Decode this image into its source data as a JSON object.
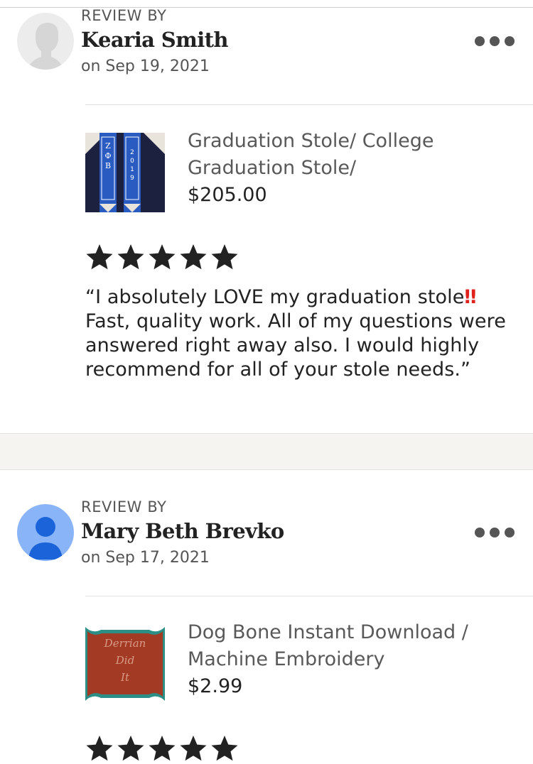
{
  "reviews": [
    {
      "review_by_label": "REVIEW BY",
      "name": "Kearia Smith",
      "date": "on Sep 19, 2021",
      "avatar": "default-silhouette-avatar",
      "menu_icon": "more-dots-icon",
      "product": {
        "title": "Graduation Stole/ College Graduation Stole/",
        "price": "$205.00",
        "image": "graduation-stole-photo"
      },
      "rating": 5,
      "text": "“I absolutely LOVE my graduation stole",
      "text_emoji": "‼",
      "text_rest": " Fast, quality work. All of my questions were answered right away also. I would highly recommend for all of your stole needs.”"
    },
    {
      "review_by_label": "REVIEW BY",
      "name": "Mary Beth Brevko",
      "date": "on Sep 17, 2021",
      "avatar": "blue-person-avatar",
      "menu_icon": "more-dots-icon",
      "product": {
        "title": "Dog Bone Instant Download / Machine Embroidery",
        "price": "$2.99",
        "image": "dog-bone-embroidery-photo",
        "image_text": [
          "Derrian",
          "Did",
          "It"
        ]
      },
      "rating": 5
    }
  ],
  "colors": {
    "star": "#222222",
    "accent_red": "#e0211b",
    "avatar_blue_bg": "#8ab4f8",
    "avatar_blue_fg": "#1a63d8"
  }
}
